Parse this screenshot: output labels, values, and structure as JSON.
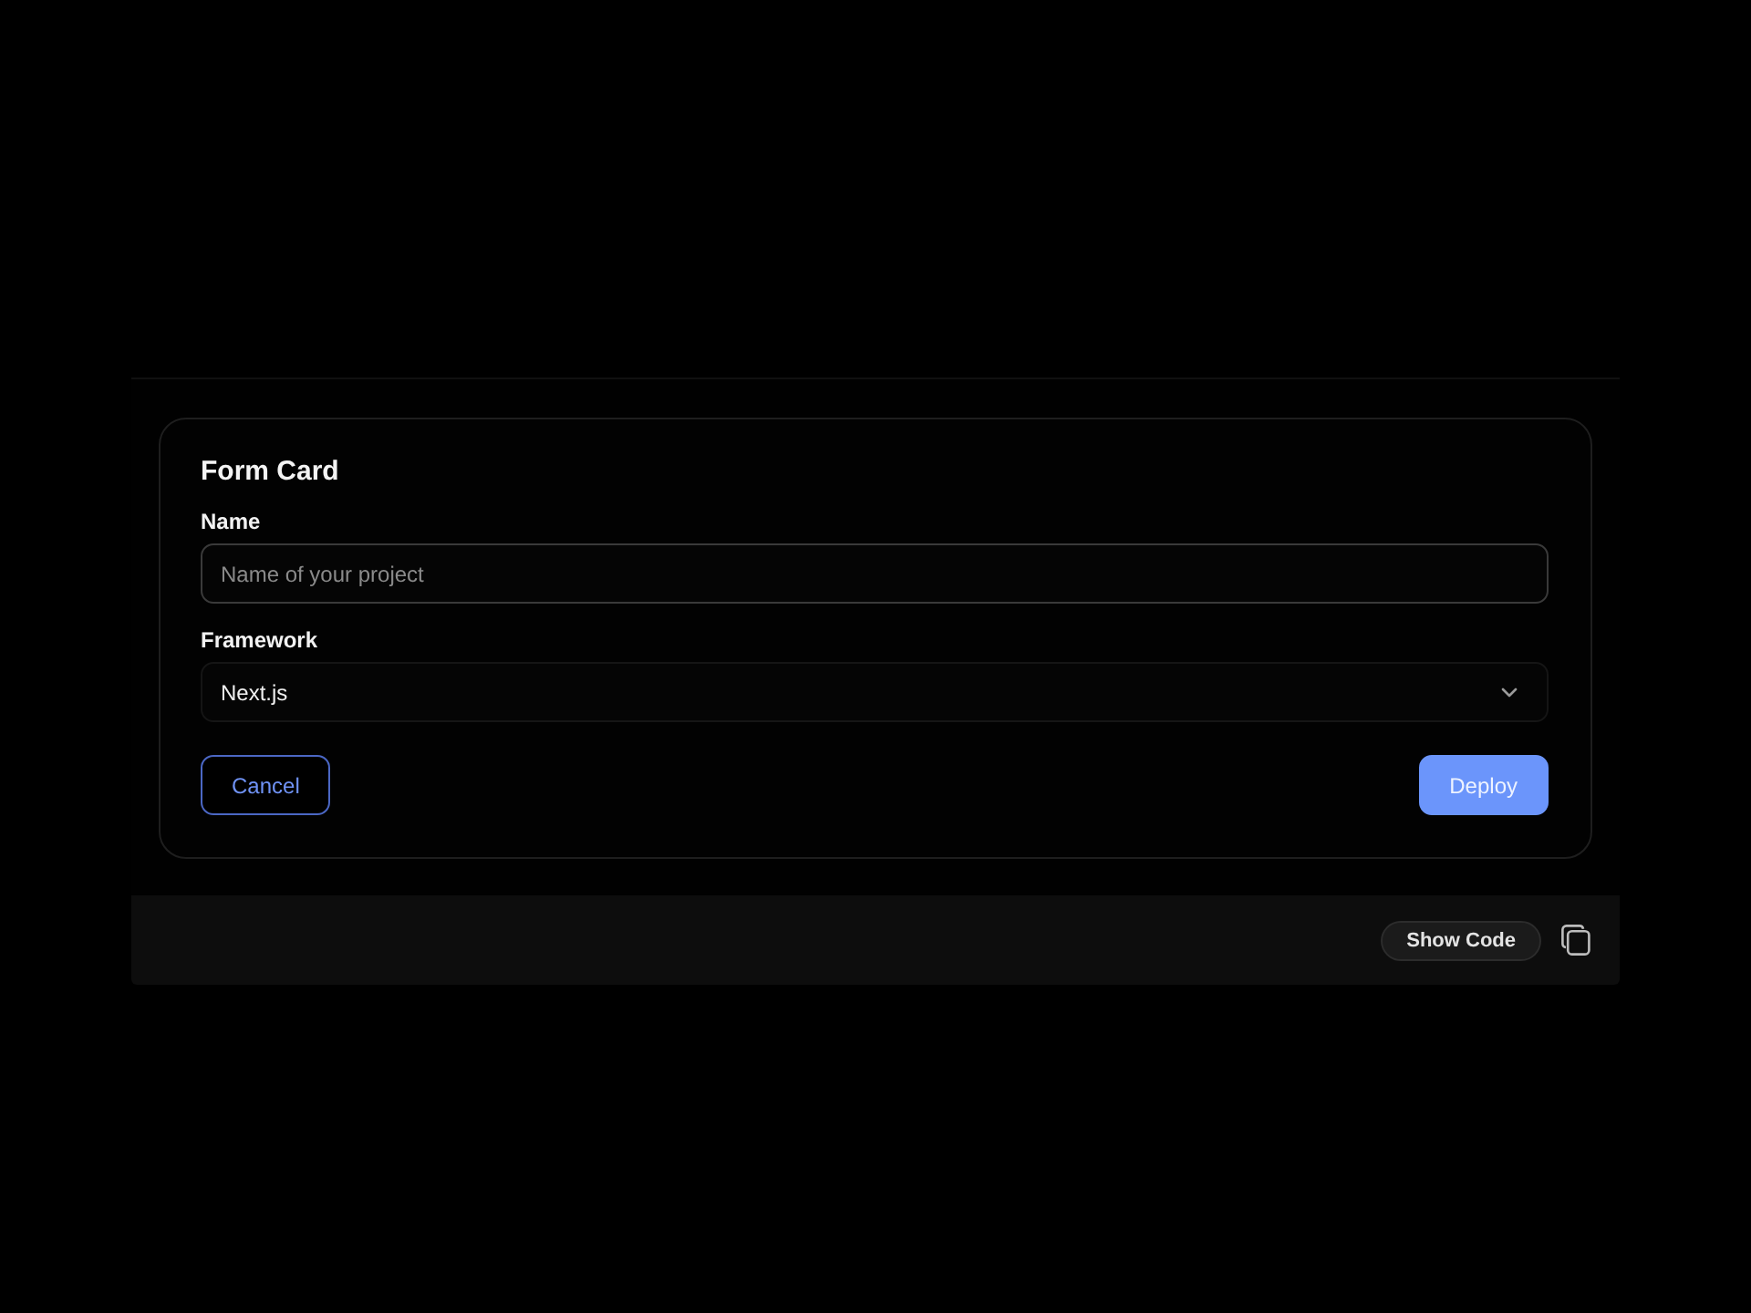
{
  "card": {
    "title": "Form Card",
    "fields": [
      {
        "kind": "text",
        "label": "Name",
        "placeholder": "Name of your project"
      },
      {
        "kind": "select",
        "label": "Framework",
        "value": "Next.js"
      }
    ],
    "buttons": [
      {
        "kind": "outline",
        "label": "Cancel"
      },
      {
        "kind": "primary",
        "label": "Deploy"
      }
    ]
  },
  "toolbar": {
    "show_code": "Show Code"
  }
}
